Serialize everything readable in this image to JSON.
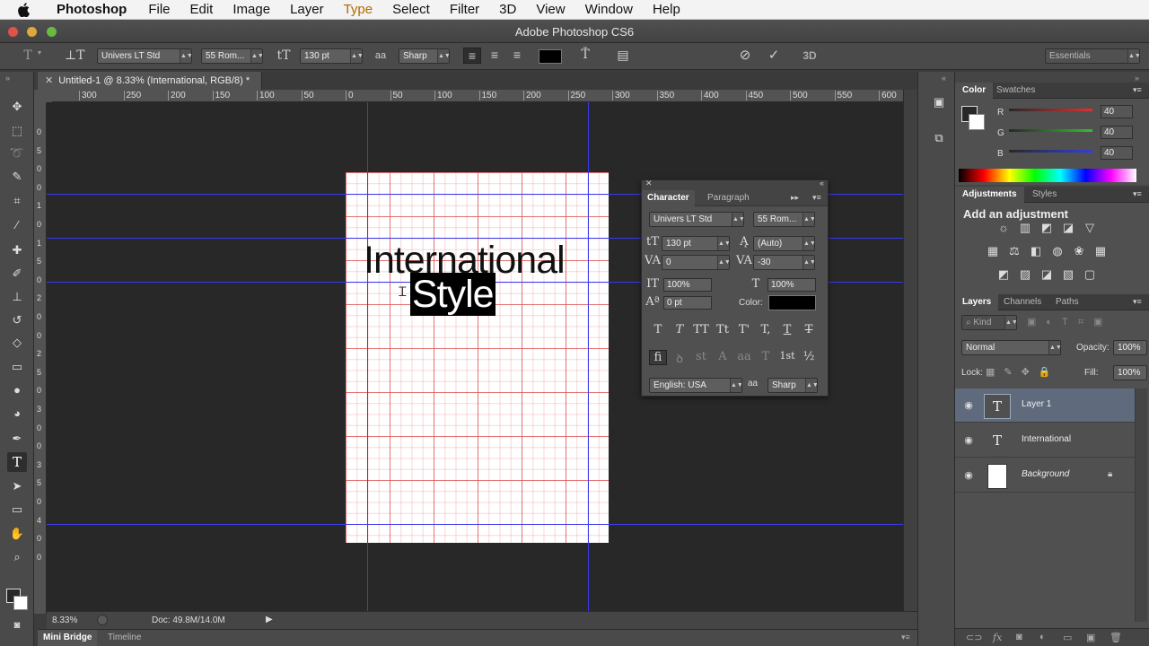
{
  "menubar": {
    "app": "Photoshop",
    "items": [
      "File",
      "Edit",
      "Image",
      "Layer",
      "Type",
      "Select",
      "Filter",
      "3D",
      "View",
      "Window",
      "Help"
    ],
    "active": "Type"
  },
  "window": {
    "title": "Adobe Photoshop CS6"
  },
  "options": {
    "font_family": "Univers LT Std",
    "font_style": "55 Rom...",
    "font_size": "130 pt",
    "antialias_icon": "aa",
    "antialias": "Sharp",
    "workspace": "Essentials",
    "commit_label": "3D"
  },
  "document": {
    "tab_title": "Untitled-1 @ 8.33% (International, RGB/8) *",
    "ruler_h": [
      "300",
      "250",
      "200",
      "150",
      "100",
      "50",
      "0",
      "50",
      "100",
      "150",
      "200",
      "250",
      "300",
      "350",
      "400",
      "450",
      "500",
      "550",
      "600"
    ],
    "ruler_v": [
      "0",
      "5",
      "0",
      "0",
      "1",
      "0",
      "1",
      "5",
      "0",
      "2",
      "0",
      "0",
      "2",
      "5",
      "0",
      "3",
      "0",
      "0",
      "3",
      "5",
      "0",
      "4",
      "0",
      "0"
    ],
    "text_line1": "International",
    "text_line2": "Style",
    "zoom": "8.33%",
    "doc_size": "Doc: 49.8M/14.0M"
  },
  "bottom_tabs": [
    "Mini Bridge",
    "Timeline"
  ],
  "character": {
    "tabs": [
      "Character",
      "Paragraph"
    ],
    "font_family": "Univers LT Std",
    "font_style": "55 Rom...",
    "size": "130 pt",
    "leading": "(Auto)",
    "kerning": "0",
    "tracking": "-30",
    "vscale": "100%",
    "hscale": "100%",
    "baseline": "0 pt",
    "color_label": "Color:",
    "style_glyphs": [
      "T",
      "T",
      "TT",
      "Tt",
      "T'",
      "T,",
      "T",
      "T"
    ],
    "ot_glyphs": [
      "fi",
      "ꝺ",
      "st",
      "A",
      "aa",
      "T",
      "1st",
      "½"
    ],
    "language": "English: USA",
    "aa_icon": "aa",
    "antialias": "Sharp"
  },
  "color_panel": {
    "tabs": [
      "Color",
      "Swatches"
    ],
    "r_label": "R",
    "g_label": "G",
    "b_label": "B",
    "r": "40",
    "g": "40",
    "b": "40"
  },
  "adjustments": {
    "tabs": [
      "Adjustments",
      "Styles"
    ],
    "heading": "Add an adjustment"
  },
  "layers": {
    "tabs": [
      "Layers",
      "Channels",
      "Paths"
    ],
    "filter": "Kind",
    "blend_mode": "Normal",
    "opacity_label": "Opacity:",
    "opacity": "100%",
    "lock_label": "Lock:",
    "fill_label": "Fill:",
    "fill": "100%",
    "items": [
      {
        "name": "Layer 1",
        "thumb": "T"
      },
      {
        "name": "International",
        "thumb": "T"
      },
      {
        "name": "Background",
        "thumb": ""
      }
    ]
  },
  "colors": {
    "guide": "#3a3af0",
    "selected_layer": "#5f6b7c",
    "r_slider": "#e03030",
    "g_slider": "#30c030",
    "b_slider": "#3040e0"
  }
}
